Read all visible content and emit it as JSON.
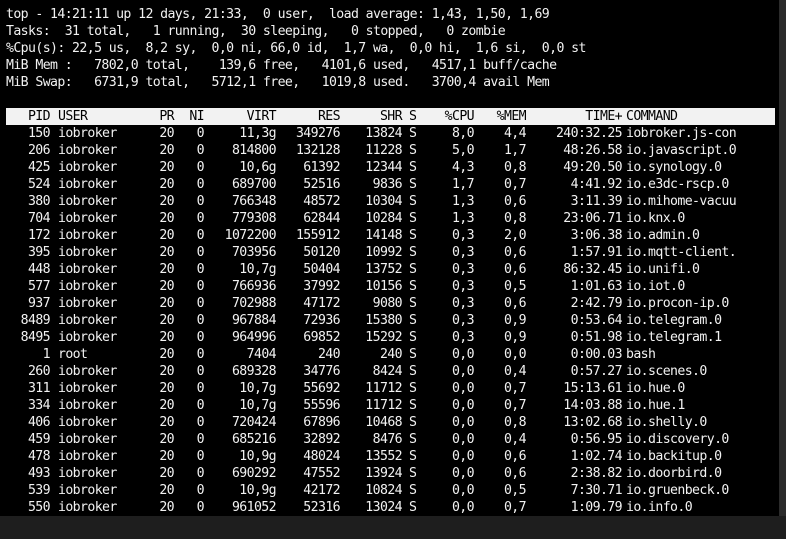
{
  "summary": {
    "line1": "top - 14:21:11 up 12 days, 21:33,  0 user,  load average: 1,43, 1,50, 1,69",
    "line2": "Tasks:  31 total,   1 running,  30 sleeping,   0 stopped,   0 zombie",
    "line3": "%Cpu(s): 22,5 us,  8,2 sy,  0,0 ni, 66,0 id,  1,7 wa,  0,0 hi,  1,6 si,  0,0 st",
    "line4": "MiB Mem :   7802,0 total,    139,6 free,   4101,6 used,   4517,1 buff/cache",
    "line5": "MiB Swap:   6731,9 total,   5712,1 free,   1019,8 used.   3700,4 avail Mem"
  },
  "table": {
    "headers": {
      "pid": "PID",
      "user": "USER",
      "pr": "PR",
      "ni": "NI",
      "virt": "VIRT",
      "res": "RES",
      "shr": "SHR",
      "s": "S",
      "cpu": "%CPU",
      "mem": "%MEM",
      "time": "TIME+",
      "command": "COMMAND"
    },
    "rows": [
      {
        "pid": "150",
        "user": "iobroker",
        "pr": "20",
        "ni": "0",
        "virt": "11,3g",
        "res": "349276",
        "shr": "13824",
        "s": "S",
        "cpu": "8,0",
        "mem": "4,4",
        "time": "240:32.25",
        "command": "iobroker.js-con"
      },
      {
        "pid": "206",
        "user": "iobroker",
        "pr": "20",
        "ni": "0",
        "virt": "814800",
        "res": "132128",
        "shr": "11228",
        "s": "S",
        "cpu": "5,0",
        "mem": "1,7",
        "time": "48:26.58",
        "command": "io.javascript.0"
      },
      {
        "pid": "425",
        "user": "iobroker",
        "pr": "20",
        "ni": "0",
        "virt": "10,6g",
        "res": "61392",
        "shr": "12344",
        "s": "S",
        "cpu": "4,3",
        "mem": "0,8",
        "time": "49:20.50",
        "command": "io.synology.0"
      },
      {
        "pid": "524",
        "user": "iobroker",
        "pr": "20",
        "ni": "0",
        "virt": "689700",
        "res": "52516",
        "shr": "9836",
        "s": "S",
        "cpu": "1,7",
        "mem": "0,7",
        "time": "4:41.92",
        "command": "io.e3dc-rscp.0"
      },
      {
        "pid": "380",
        "user": "iobroker",
        "pr": "20",
        "ni": "0",
        "virt": "766348",
        "res": "48572",
        "shr": "10304",
        "s": "S",
        "cpu": "1,3",
        "mem": "0,6",
        "time": "3:11.39",
        "command": "io.mihome-vacuu"
      },
      {
        "pid": "704",
        "user": "iobroker",
        "pr": "20",
        "ni": "0",
        "virt": "779308",
        "res": "62844",
        "shr": "10284",
        "s": "S",
        "cpu": "1,3",
        "mem": "0,8",
        "time": "23:06.71",
        "command": "io.knx.0"
      },
      {
        "pid": "172",
        "user": "iobroker",
        "pr": "20",
        "ni": "0",
        "virt": "1072200",
        "res": "155912",
        "shr": "14148",
        "s": "S",
        "cpu": "0,3",
        "mem": "2,0",
        "time": "3:06.38",
        "command": "io.admin.0"
      },
      {
        "pid": "395",
        "user": "iobroker",
        "pr": "20",
        "ni": "0",
        "virt": "703956",
        "res": "50120",
        "shr": "10992",
        "s": "S",
        "cpu": "0,3",
        "mem": "0,6",
        "time": "1:57.91",
        "command": "io.mqtt-client."
      },
      {
        "pid": "448",
        "user": "iobroker",
        "pr": "20",
        "ni": "0",
        "virt": "10,7g",
        "res": "50404",
        "shr": "13752",
        "s": "S",
        "cpu": "0,3",
        "mem": "0,6",
        "time": "86:32.45",
        "command": "io.unifi.0"
      },
      {
        "pid": "577",
        "user": "iobroker",
        "pr": "20",
        "ni": "0",
        "virt": "766936",
        "res": "37992",
        "shr": "10156",
        "s": "S",
        "cpu": "0,3",
        "mem": "0,5",
        "time": "1:01.63",
        "command": "io.iot.0"
      },
      {
        "pid": "937",
        "user": "iobroker",
        "pr": "20",
        "ni": "0",
        "virt": "702988",
        "res": "47172",
        "shr": "9080",
        "s": "S",
        "cpu": "0,3",
        "mem": "0,6",
        "time": "2:42.79",
        "command": "io.procon-ip.0"
      },
      {
        "pid": "8489",
        "user": "iobroker",
        "pr": "20",
        "ni": "0",
        "virt": "967884",
        "res": "72936",
        "shr": "15380",
        "s": "S",
        "cpu": "0,3",
        "mem": "0,9",
        "time": "0:53.64",
        "command": "io.telegram.0"
      },
      {
        "pid": "8495",
        "user": "iobroker",
        "pr": "20",
        "ni": "0",
        "virt": "964996",
        "res": "69852",
        "shr": "15292",
        "s": "S",
        "cpu": "0,3",
        "mem": "0,9",
        "time": "0:51.98",
        "command": "io.telegram.1"
      },
      {
        "pid": "1",
        "user": "root",
        "pr": "20",
        "ni": "0",
        "virt": "7404",
        "res": "240",
        "shr": "240",
        "s": "S",
        "cpu": "0,0",
        "mem": "0,0",
        "time": "0:00.03",
        "command": "bash"
      },
      {
        "pid": "260",
        "user": "iobroker",
        "pr": "20",
        "ni": "0",
        "virt": "689328",
        "res": "34776",
        "shr": "8424",
        "s": "S",
        "cpu": "0,0",
        "mem": "0,4",
        "time": "0:57.27",
        "command": "io.scenes.0"
      },
      {
        "pid": "311",
        "user": "iobroker",
        "pr": "20",
        "ni": "0",
        "virt": "10,7g",
        "res": "55692",
        "shr": "11712",
        "s": "S",
        "cpu": "0,0",
        "mem": "0,7",
        "time": "15:13.61",
        "command": "io.hue.0"
      },
      {
        "pid": "334",
        "user": "iobroker",
        "pr": "20",
        "ni": "0",
        "virt": "10,7g",
        "res": "55596",
        "shr": "11712",
        "s": "S",
        "cpu": "0,0",
        "mem": "0,7",
        "time": "14:03.88",
        "command": "io.hue.1"
      },
      {
        "pid": "406",
        "user": "iobroker",
        "pr": "20",
        "ni": "0",
        "virt": "720424",
        "res": "67896",
        "shr": "10468",
        "s": "S",
        "cpu": "0,0",
        "mem": "0,8",
        "time": "13:02.68",
        "command": "io.shelly.0"
      },
      {
        "pid": "459",
        "user": "iobroker",
        "pr": "20",
        "ni": "0",
        "virt": "685216",
        "res": "32892",
        "shr": "8476",
        "s": "S",
        "cpu": "0,0",
        "mem": "0,4",
        "time": "0:56.95",
        "command": "io.discovery.0"
      },
      {
        "pid": "478",
        "user": "iobroker",
        "pr": "20",
        "ni": "0",
        "virt": "10,9g",
        "res": "48024",
        "shr": "13552",
        "s": "S",
        "cpu": "0,0",
        "mem": "0,6",
        "time": "1:02.74",
        "command": "io.backitup.0"
      },
      {
        "pid": "493",
        "user": "iobroker",
        "pr": "20",
        "ni": "0",
        "virt": "690292",
        "res": "47552",
        "shr": "13924",
        "s": "S",
        "cpu": "0,0",
        "mem": "0,6",
        "time": "2:38.82",
        "command": "io.doorbird.0"
      },
      {
        "pid": "539",
        "user": "iobroker",
        "pr": "20",
        "ni": "0",
        "virt": "10,9g",
        "res": "42172",
        "shr": "10824",
        "s": "S",
        "cpu": "0,0",
        "mem": "0,5",
        "time": "7:30.71",
        "command": "io.gruenbeck.0"
      },
      {
        "pid": "550",
        "user": "iobroker",
        "pr": "20",
        "ni": "0",
        "virt": "961052",
        "res": "52316",
        "shr": "13024",
        "s": "S",
        "cpu": "0,0",
        "mem": "0,7",
        "time": "1:09.79",
        "command": "io.info.0"
      }
    ]
  }
}
